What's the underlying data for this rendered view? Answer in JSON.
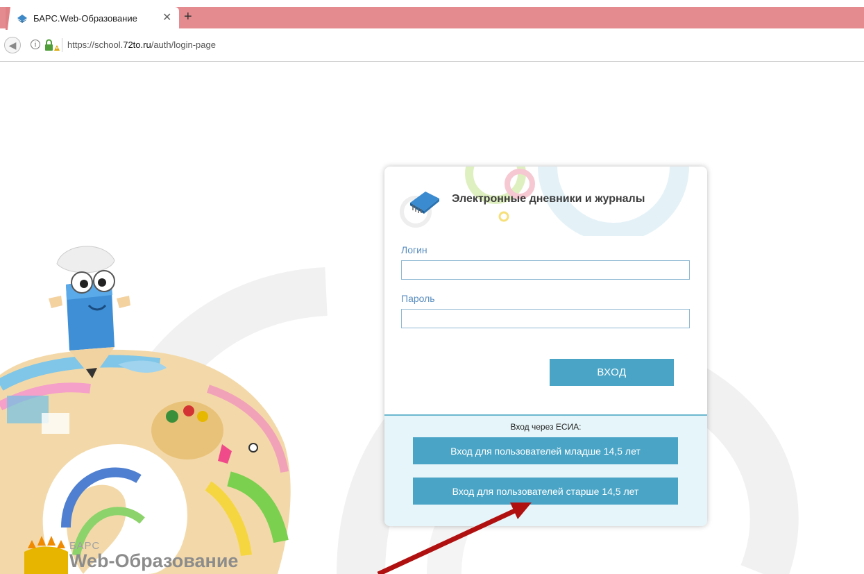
{
  "browser": {
    "tab_title": "БАРС.Web-Образование",
    "tab_close": "✕",
    "new_tab": "+",
    "url_prefix": "https://school.",
    "url_host": "72to.ru",
    "url_path": "/auth/login-page"
  },
  "login": {
    "title": "Электронные дневники и журналы",
    "login_label": "Логин",
    "login_value": "",
    "password_label": "Пароль",
    "password_value": "",
    "submit_label": "ВХОД"
  },
  "esia": {
    "caption": "Вход через ЕСИА:",
    "under_14_label": "Вход для пользователей младше 14,5 лет",
    "over_14_label": "Вход для пользователей старше 14,5 лет"
  },
  "brand": {
    "small": "БАРС",
    "big": "Web-Образование"
  },
  "colors": {
    "tabstrip": "#e38b8f",
    "button": "#49a4c6",
    "esia_bg": "#e6f5f9",
    "arrow": "#b01010"
  }
}
